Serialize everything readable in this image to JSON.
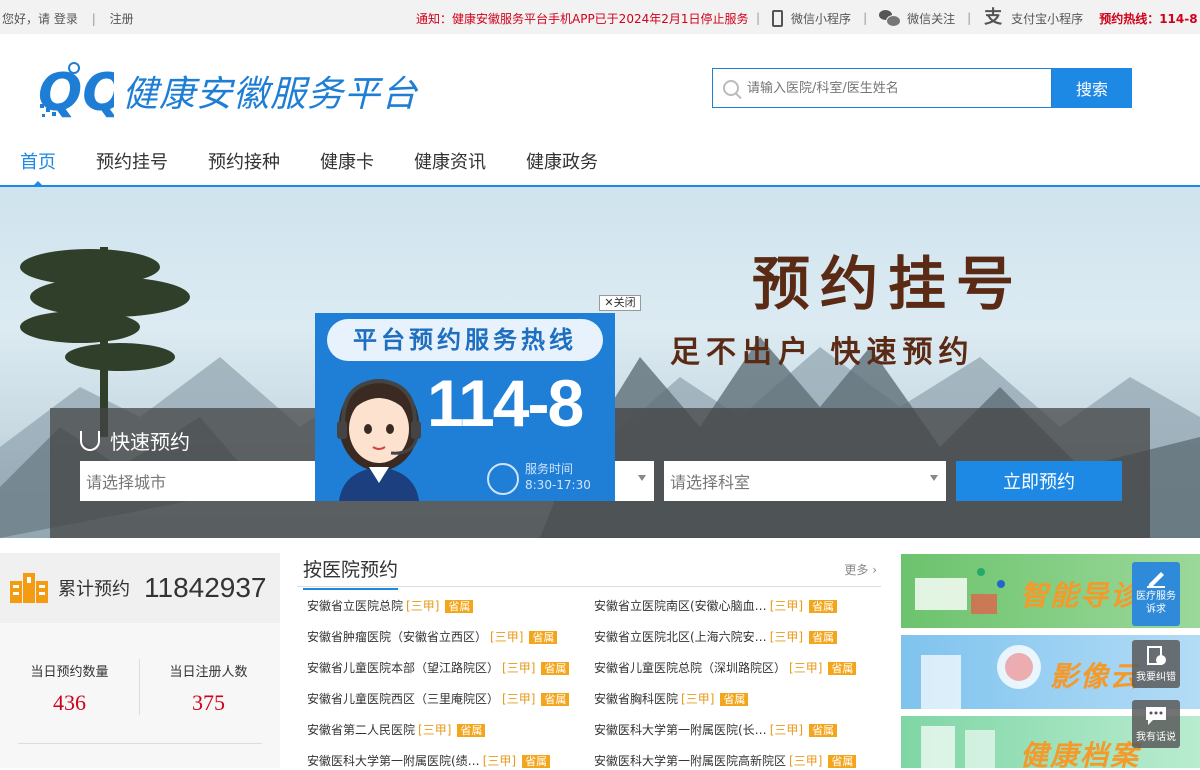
{
  "topbar": {
    "greeting": "您好，请",
    "login": "登录",
    "register": "注册",
    "notice": "通知：健康安徽服务平台手机APP已于2024年2月1日停止服务",
    "wechat_mini": "微信小程序",
    "wechat_follow": "微信关注",
    "alipay_mini": "支付宝小程序",
    "hotline": "预约热线：114-8"
  },
  "logo": {
    "text": "健康安徽服务平台"
  },
  "search": {
    "placeholder": "请输入医院/科室/医生姓名",
    "button": "搜索"
  },
  "nav": [
    "首页",
    "预约挂号",
    "预约接种",
    "健康卡",
    "健康资讯",
    "健康政务"
  ],
  "banner": {
    "title": "预约挂号",
    "subtitle": "足不出户 快速预约"
  },
  "quick": {
    "title": "快速预约",
    "city_placeholder": "请选择城市",
    "dept_placeholder": "请选择科室",
    "button": "立即预约"
  },
  "popup": {
    "close": "✕关闭",
    "title": "平台预约服务热线",
    "number": "114-8",
    "service_label": "服务时间",
    "service_time": "8:30-17:30"
  },
  "stats": {
    "total_label": "累计预约",
    "total_value": "11842937",
    "today_appt_label": "当日预约数量",
    "today_appt_value": "436",
    "today_reg_label": "当日注册人数",
    "today_reg_value": "375"
  },
  "hospitals": {
    "title": "按医院预约",
    "more": "更多",
    "items": [
      {
        "name": "安徽省立医院总院",
        "grade": "[三甲]",
        "tag": "省属"
      },
      {
        "name": "安徽省立医院南区(安徽心脑血…",
        "grade": "[三甲]",
        "tag": "省属"
      },
      {
        "name": "安徽省肿瘤医院（安徽省立西区）",
        "grade": "[三甲]",
        "tag": "省属"
      },
      {
        "name": "安徽省立医院北区(上海六院安…",
        "grade": "[三甲]",
        "tag": "省属"
      },
      {
        "name": "安徽省儿童医院本部（望江路院区）",
        "grade": "[三甲]",
        "tag": "省属"
      },
      {
        "name": "安徽省儿童医院总院（深圳路院区）",
        "grade": "[三甲]",
        "tag": "省属"
      },
      {
        "name": "安徽省儿童医院西区（三里庵院区）",
        "grade": "[三甲]",
        "tag": "省属"
      },
      {
        "name": "安徽省胸科医院",
        "grade": "[三甲]",
        "tag": "省属"
      },
      {
        "name": "安徽省第二人民医院",
        "grade": "[三甲]",
        "tag": "省属"
      },
      {
        "name": "安徽医科大学第一附属医院(长…",
        "grade": "[三甲]",
        "tag": "省属"
      },
      {
        "name": "安徽医科大学第一附属医院(绩…",
        "grade": "[三甲]",
        "tag": "省属"
      },
      {
        "name": "安徽医科大学第一附属医院高新院区",
        "grade": "[三甲]",
        "tag": "省属"
      }
    ]
  },
  "right_panels": [
    "智能导诊",
    "影像云",
    "健康档案"
  ],
  "floats": [
    "医疗服务诉求",
    "我要纠错",
    "我有话说"
  ],
  "colors": {
    "primary": "#1e88e5",
    "notice": "#d0021b",
    "tag": "#f3a51b"
  }
}
